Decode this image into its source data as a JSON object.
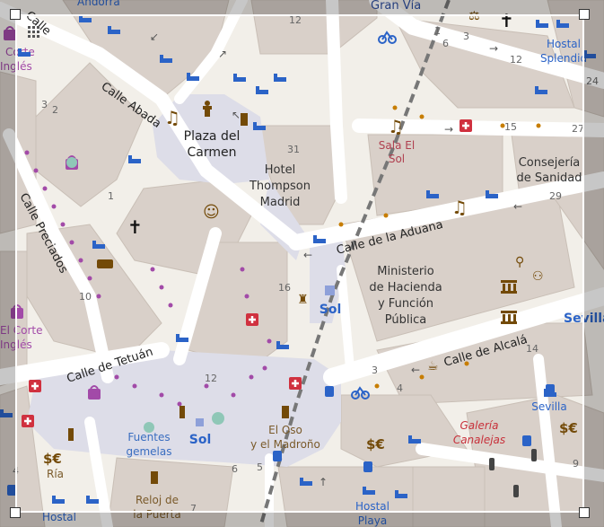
{
  "map": {
    "places": {
      "plaza_del_carmen_1": "Plaza del",
      "plaza_del_carmen_2": "Carmen",
      "hotel_1": "Hotel",
      "hotel_2": "Thompson",
      "hotel_3": "Madrid",
      "ministerio_1": "Ministerio",
      "ministerio_2": "de Hacienda",
      "ministerio_3": "y Función",
      "ministerio_4": "Pública",
      "consejeria_1": "Consejería",
      "consejeria_2": "de Sanidad",
      "sala_1": "Sala El",
      "sala_2": "Sol",
      "el_oso_1": "El Oso",
      "el_oso_2": "y el Madroño",
      "fuentes_1": "Fuentes",
      "fuentes_2": "gemelas",
      "reloj_1": "Reloj de",
      "reloj_2": "la Puerta",
      "galeria_1": "Galería",
      "galeria_2": "Canalejas",
      "ria": "Ría",
      "corte_top_1": "Corte",
      "corte_top_2": "Inglés",
      "corte_mid_1": "El Corte",
      "corte_mid_2": "Inglés",
      "andorra": "Andorra"
    },
    "streets": {
      "calle_abada": "Calle Abada",
      "calle_preciados": "Calle Preciados",
      "calle_aduana": "Calle de la Aduana",
      "calle_alcala": "Calle de Alcalá",
      "calle_tetuan": "Calle de Tetuán",
      "gran_via": "Gran Vía",
      "calle_top": "Calle"
    },
    "transit": {
      "sol_top": "Sol",
      "sol_bottom": "Sol",
      "sevilla_right": "Sevilla",
      "sevilla_small": "Sevilla",
      "hostal_splendid_1": "Hostal",
      "hostal_splendid_2": "Splendid",
      "hostal_bottom": "Hostal",
      "hostal_playa_1": "Hostal",
      "hostal_playa_2": "Playa"
    },
    "house_numbers": {
      "n12_top": "12",
      "n1_top": "1",
      "n3_top": "3",
      "n6_top": "6",
      "n12_right": "12",
      "n24": "24",
      "n15": "15",
      "n27": "27",
      "n31": "31",
      "n29": "29",
      "n3_left": "3",
      "n2_left": "2",
      "n1_left": "1",
      "n10": "10",
      "n16": "16",
      "n12_bottom": "12",
      "n3_mid": "3",
      "n4_mid": "4",
      "n14": "14",
      "n6_bottom": "6",
      "n5_bottom": "5",
      "n7": "7",
      "n9": "9",
      "n4_left": "4"
    },
    "colors": {
      "background": "#f2efe9",
      "road": "#ffffff",
      "building": "#d9d0c9",
      "pedestrian": "#dddde8",
      "transit_blue": "#2b63c7",
      "poi_red": "#d0313f",
      "poi_brown": "#734a08",
      "poi_purple": "#a24aa8"
    },
    "icons": [
      "bed-icon",
      "music-note-icon",
      "church-cross-icon",
      "theatre-mask-icon",
      "bank-icon",
      "bus-stop-icon",
      "bicycle-rental-icon",
      "pharmacy-cross-icon",
      "metro-sol-icon",
      "statue-icon",
      "fountain-icon",
      "currency-exchange-icon",
      "traffic-light-icon",
      "toilets-icon",
      "shop-bag-icon",
      "police-icon"
    ]
  }
}
